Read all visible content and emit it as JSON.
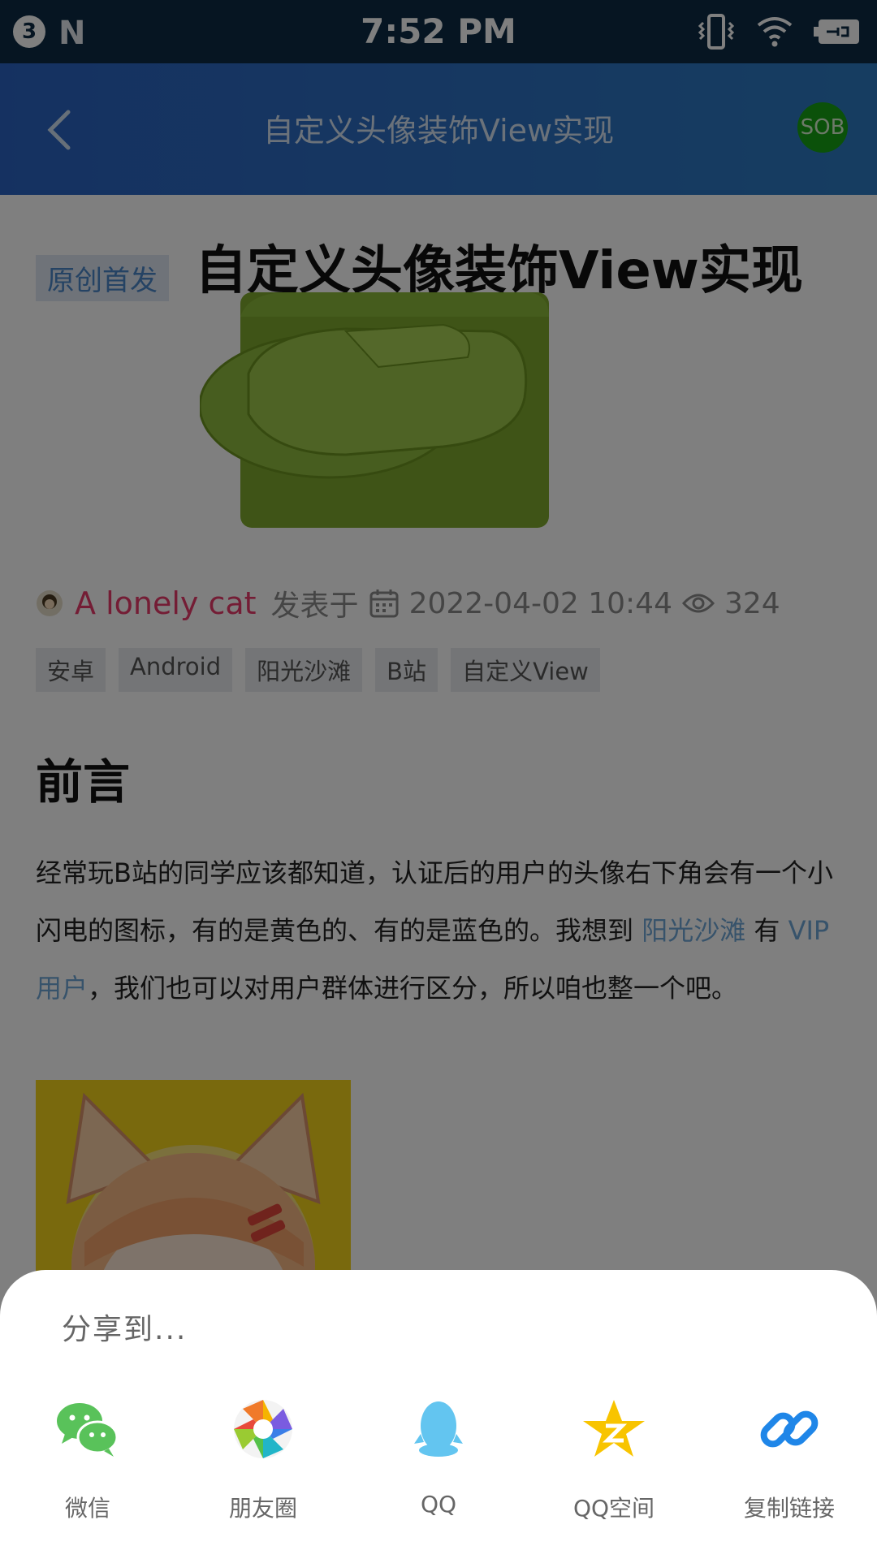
{
  "status_bar": {
    "badge_count": "3",
    "notif_icon": "N",
    "time": "7:52 PM",
    "icons": [
      "vibrate-icon",
      "wifi-icon",
      "battery-charging-icon"
    ]
  },
  "app_bar": {
    "title": "自定义头像装饰View实现",
    "avatar_text": "SOB"
  },
  "article": {
    "badge": "原创首发",
    "title": "自定义头像装饰View实现",
    "author": "A lonely cat",
    "published_label": "发表于",
    "date": "2022-04-02 10:44",
    "views": "324",
    "tags": [
      "安卓",
      "Android",
      "阳光沙滩",
      "B站",
      "自定义View"
    ],
    "section_heading": "前言",
    "paragraph": {
      "p1": "经常玩B站的同学应该都知道，认证后的用户的头像右下角会有一个小闪电的图标，有的是黄色的、有的是蓝色的。我想到 ",
      "link1": "阳光沙滩",
      "p2": " 有 ",
      "link2": "VIP 用户",
      "p3": "，我们也可以对用户群体进行区分，所以咱也整一个吧。"
    }
  },
  "share_sheet": {
    "title": "分享到...",
    "items": [
      {
        "label": "微信",
        "icon": "wechat-icon"
      },
      {
        "label": "朋友圈",
        "icon": "moments-icon"
      },
      {
        "label": "QQ",
        "icon": "qq-icon"
      },
      {
        "label": "QQ空间",
        "icon": "qzone-icon"
      },
      {
        "label": "复制链接",
        "icon": "copy-link-icon"
      }
    ]
  }
}
